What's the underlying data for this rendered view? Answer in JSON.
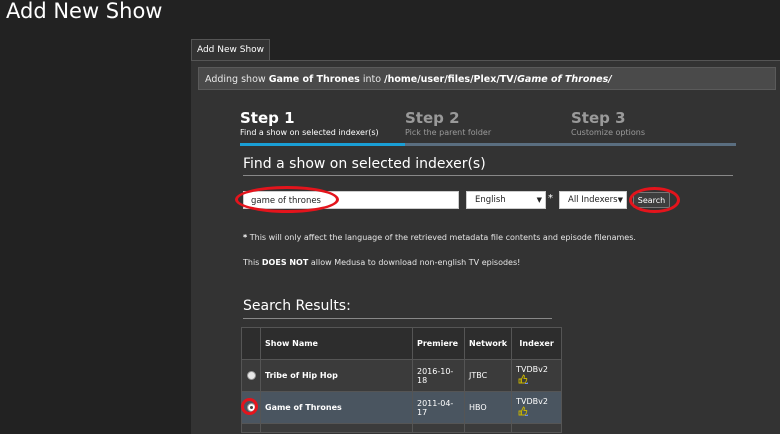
{
  "page_title": "Add New Show",
  "tab_label": "Add New Show",
  "info": {
    "prefix": "Adding show",
    "show": "Game of Thrones",
    "middle": "into",
    "path": "/home/user/files/Plex/TV/",
    "path_italic": "Game of Thrones/"
  },
  "steps": [
    {
      "title": "Step 1",
      "desc": "Find a show on selected indexer(s)",
      "active": true
    },
    {
      "title": "Step 2",
      "desc": "Pick the parent folder",
      "active": false
    },
    {
      "title": "Step 3",
      "desc": "Customize options",
      "active": false
    }
  ],
  "find": {
    "title": "Find a show on selected indexer(s)",
    "search_value": "game of thrones",
    "language": "English",
    "indexer": "All Indexers",
    "required_mark": "*",
    "search_button": "Search"
  },
  "notes": {
    "line1_star": "*",
    "line1": "This will only affect the language of the retrieved metadata file contents and episode filenames.",
    "line2_pre": "This",
    "line2_bold": "DOES NOT",
    "line2_post": "allow Medusa to download non-english TV episodes!"
  },
  "results": {
    "title": "Search Results:",
    "columns": [
      "Show Name",
      "Premiere",
      "Network",
      "Indexer"
    ],
    "rows": [
      {
        "name": "Tribe of Hip Hop",
        "premiere": "2016-10-18",
        "network": "JTBC",
        "indexer": "TVDBv2",
        "selected": false
      },
      {
        "name": "Game of Thrones",
        "premiere": "2011-04-17",
        "network": "HBO",
        "indexer": "TVDBv2",
        "selected": true
      }
    ]
  },
  "colors": {
    "step_active": "#1a9fd6",
    "step_inactive": "#5a6e80",
    "highlight_ring": "#e4141c",
    "thumb_icon": "#c8b400"
  }
}
